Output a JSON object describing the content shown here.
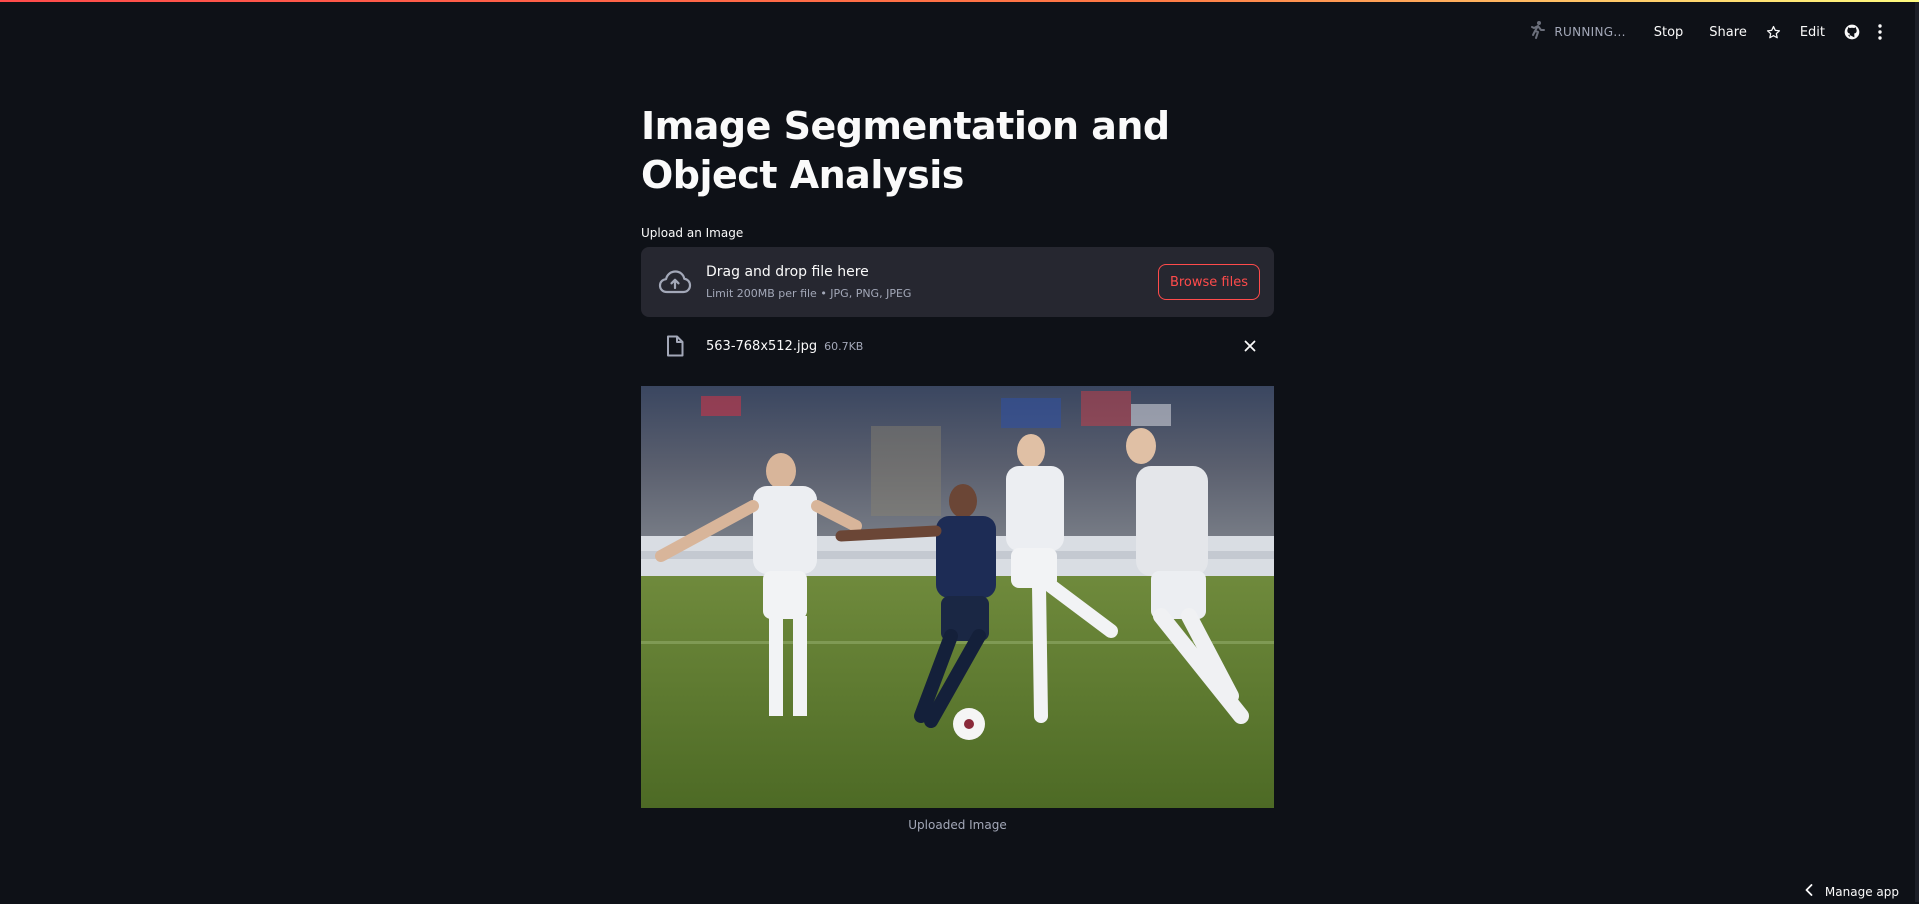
{
  "toolbar": {
    "status": "RUNNING...",
    "stop_label": "Stop",
    "share_label": "Share",
    "edit_label": "Edit"
  },
  "main": {
    "title": "Image Segmentation and Object Analysis",
    "upload_label": "Upload an Image",
    "dropzone": {
      "primary_text": "Drag and drop file here",
      "secondary_text": "Limit 200MB per file • JPG, PNG, JPEG",
      "browse_label": "Browse files"
    },
    "file": {
      "name": "563-768x512.jpg",
      "size": "60.7KB"
    },
    "image_caption": "Uploaded Image"
  },
  "footer": {
    "manage_app_label": "Manage app"
  },
  "colors": {
    "background": "#0e1117",
    "accent": "#ff4b4b",
    "surface": "#262730",
    "muted_text": "#a3a8b8"
  },
  "icons": [
    "running-man-icon",
    "star-icon",
    "github-icon",
    "kebab-menu-icon",
    "cloud-upload-icon",
    "file-icon",
    "close-icon",
    "chevron-left-icon"
  ]
}
